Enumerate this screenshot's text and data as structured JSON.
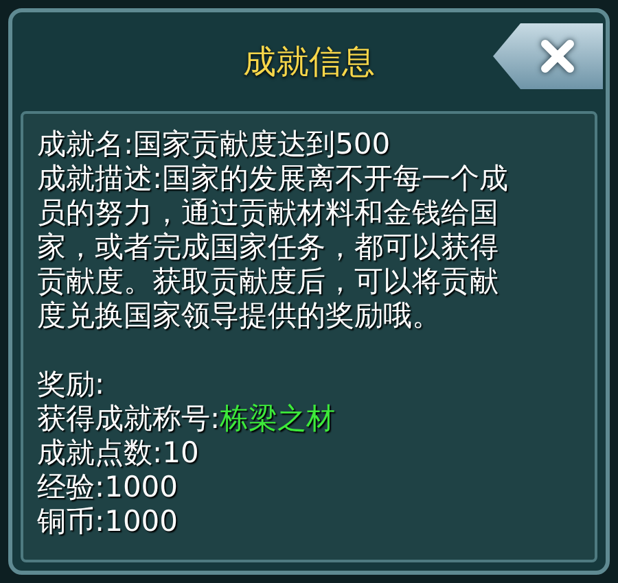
{
  "title": "成就信息",
  "details": [
    {
      "text": "成就名:国家贡献度达到500"
    },
    {
      "text": "成就描述:国家的发展离不开每一个成员的努力，通过贡献材料和金钱给国家，或者完成国家任务，都可以获得贡献度。获取贡献度后，可以将贡献度兑换国家领导提供的奖励哦。"
    }
  ],
  "rewards": {
    "heading": "奖励:",
    "items": [
      {
        "label": "获得成就称号:",
        "value": "栋梁之材",
        "highlight": true
      },
      {
        "label": "成就点数:",
        "value": "10",
        "highlight": false
      },
      {
        "label": "经验:",
        "value": "1000",
        "highlight": false
      },
      {
        "label": "铜币:",
        "value": "1000",
        "highlight": false
      }
    ]
  }
}
